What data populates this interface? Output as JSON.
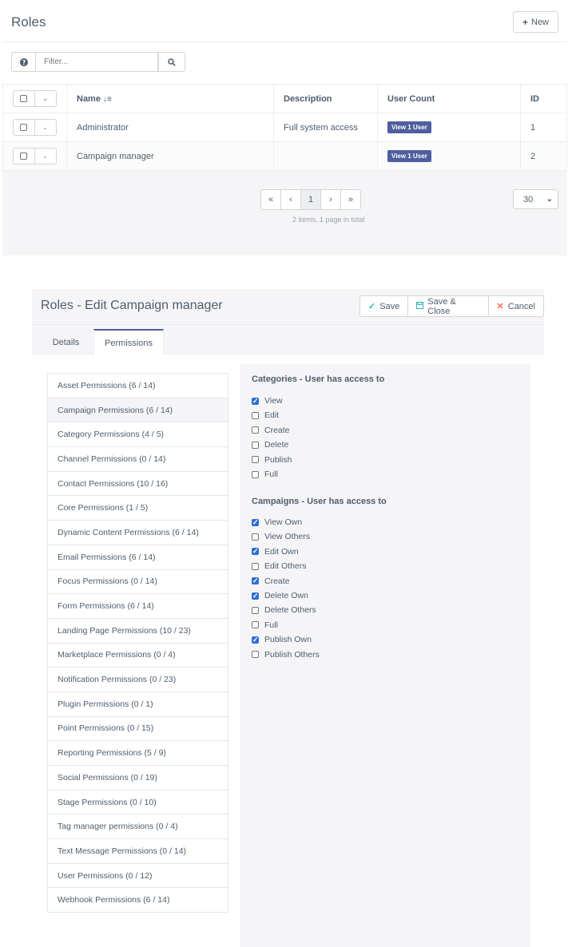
{
  "roles_list": {
    "title": "Roles",
    "new_button": "New",
    "filter": {
      "placeholder": "Filter..."
    },
    "columns": {
      "name": "Name",
      "description": "Description",
      "user_count": "User Count",
      "id": "ID"
    },
    "rows": [
      {
        "name": "Administrator",
        "description": "Full system access",
        "user_count": "View 1 User",
        "id": "1"
      },
      {
        "name": "Campaign manager",
        "description": "",
        "user_count": "View 1 User",
        "id": "2"
      }
    ],
    "pagination": {
      "first": "«",
      "prev": "‹",
      "current": "1",
      "next": "›",
      "last": "»",
      "info": "2 items, 1 page in total",
      "per_page": "30"
    }
  },
  "edit_panel": {
    "title": "Roles - Edit Campaign manager",
    "save": "Save",
    "save_close": "Save & Close",
    "cancel": "Cancel",
    "tabs": {
      "details": "Details",
      "permissions": "Permissions"
    },
    "permission_groups": [
      "Asset Permissions (6 / 14)",
      "Campaign Permissions (6 / 14)",
      "Category Permissions (4 / 5)",
      "Channel Permissions (0 / 14)",
      "Contact Permissions (10 / 16)",
      "Core Permissions (1 / 5)",
      "Dynamic Content Permissions (6 / 14)",
      "Email Permissions (6 / 14)",
      "Focus Permissions (0 / 14)",
      "Form Permissions (6 / 14)",
      "Landing Page Permissions (10 / 23)",
      "Marketplace Permissions (0 / 4)",
      "Notification Permissions (0 / 23)",
      "Plugin Permissions (0 / 1)",
      "Point Permissions (0 / 15)",
      "Reporting Permissions (5 / 9)",
      "Social Permissions (0 / 19)",
      "Stage Permissions (0 / 10)",
      "Tag manager permissions (0 / 4)",
      "Text Message Permissions (0 / 14)",
      "User Permissions (0 / 12)",
      "Webhook Permissions (6 / 14)"
    ],
    "categories_section": {
      "title": "Categories - User has access to",
      "options": [
        {
          "label": "View",
          "checked": true
        },
        {
          "label": "Edit",
          "checked": false
        },
        {
          "label": "Create",
          "checked": false
        },
        {
          "label": "Delete",
          "checked": false
        },
        {
          "label": "Publish",
          "checked": false
        },
        {
          "label": "Full",
          "checked": false
        }
      ]
    },
    "campaigns_section": {
      "title": "Campaigns - User has access to",
      "options": [
        {
          "label": "View Own",
          "checked": true
        },
        {
          "label": "View Others",
          "checked": false
        },
        {
          "label": "Edit Own",
          "checked": true
        },
        {
          "label": "Edit Others",
          "checked": false
        },
        {
          "label": "Create",
          "checked": true
        },
        {
          "label": "Delete Own",
          "checked": true
        },
        {
          "label": "Delete Others",
          "checked": false
        },
        {
          "label": "Full",
          "checked": false
        },
        {
          "label": "Publish Own",
          "checked": true
        },
        {
          "label": "Publish Others",
          "checked": false
        }
      ]
    }
  }
}
